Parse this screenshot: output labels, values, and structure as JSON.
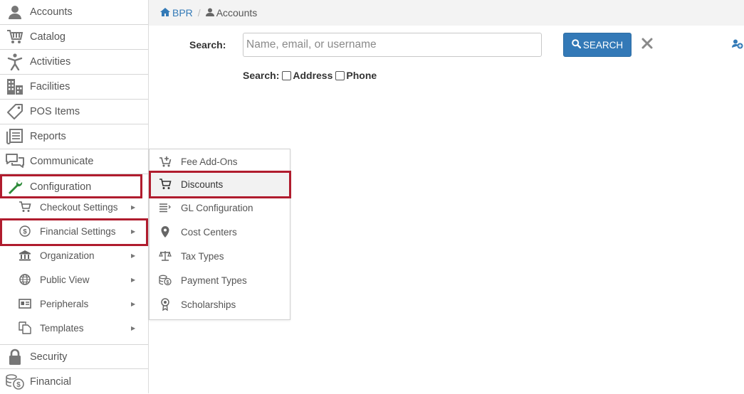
{
  "breadcrumb": {
    "home": "BPR",
    "separator": "/",
    "current": "Accounts"
  },
  "search": {
    "label": "Search:",
    "placeholder": "Name, email, or username",
    "value": "",
    "button_label": "SEARCH",
    "options_label": "Search:",
    "option_address": "Address",
    "option_phone": "Phone"
  },
  "sidebar": {
    "items": [
      {
        "label": "Accounts",
        "icon": "user-icon"
      },
      {
        "label": "Catalog",
        "icon": "cart-icon"
      },
      {
        "label": "Activities",
        "icon": "person-activity-icon"
      },
      {
        "label": "Facilities",
        "icon": "building-icon"
      },
      {
        "label": "POS Items",
        "icon": "tag-icon"
      },
      {
        "label": "Reports",
        "icon": "reports-icon"
      },
      {
        "label": "Communicate",
        "icon": "chat-icon"
      },
      {
        "label": "Configuration",
        "icon": "wrench-icon"
      },
      {
        "label": "Security",
        "icon": "lock-icon"
      },
      {
        "label": "Financial",
        "icon": "coins-icon"
      }
    ],
    "config_sub": [
      {
        "label": "Checkout Settings",
        "icon": "cart-icon"
      },
      {
        "label": "Financial Settings",
        "icon": "dollar-circle-icon"
      },
      {
        "label": "Organization",
        "icon": "bank-icon"
      },
      {
        "label": "Public View",
        "icon": "globe-icon"
      },
      {
        "label": "Peripherals",
        "icon": "id-card-icon"
      },
      {
        "label": "Templates",
        "icon": "copy-icon"
      }
    ]
  },
  "flyout": {
    "items": [
      {
        "label": "Fee Add-Ons",
        "icon": "cart-plus-icon"
      },
      {
        "label": "Discounts",
        "icon": "cart-icon"
      },
      {
        "label": "GL Configuration",
        "icon": "list-icon"
      },
      {
        "label": "Cost Centers",
        "icon": "map-pin-icon"
      },
      {
        "label": "Tax Types",
        "icon": "scale-icon"
      },
      {
        "label": "Payment Types",
        "icon": "coins-icon"
      },
      {
        "label": "Scholarships",
        "icon": "award-icon"
      }
    ]
  },
  "colors": {
    "accent": "#3379b7",
    "highlight": "#b01c2e",
    "icon": "#666666",
    "wrench": "#2e8b3a"
  }
}
